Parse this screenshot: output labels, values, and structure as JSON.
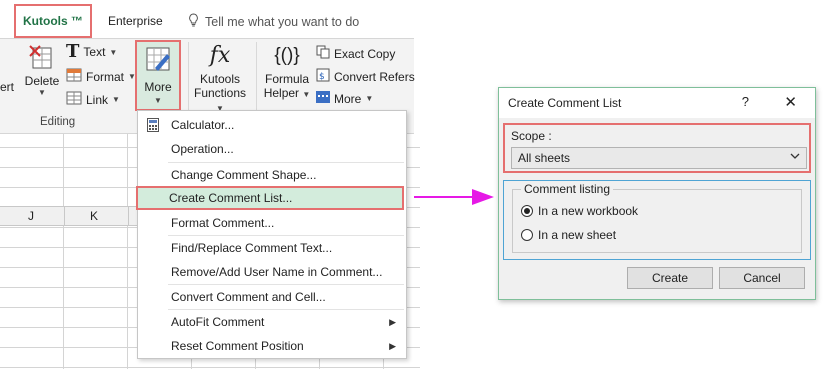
{
  "ribbon": {
    "tabs": {
      "kutools": "Kutools ™",
      "enterprise": "Enterprise"
    },
    "tell_me": "Tell me what you want to do",
    "editing": {
      "ert_label": "ert",
      "delete_label": "Delete",
      "text_label": "Text",
      "format_label": "Format",
      "link_label": "Link",
      "group_label": "Editing"
    },
    "more_label": "More",
    "functions": {
      "line1": "Kutools",
      "line2": "Functions"
    },
    "formula": {
      "line1": "Formula",
      "line2": "Helper"
    },
    "exact_copy": "Exact Copy",
    "convert_refers": "Convert Refers",
    "more_small": "More"
  },
  "sheet": {
    "columns": [
      "J",
      "K"
    ]
  },
  "menu": {
    "items": [
      {
        "label": "Calculator..."
      },
      {
        "label": "Operation..."
      },
      {
        "label": "Change Comment Shape..."
      },
      {
        "label": "Create Comment List..."
      },
      {
        "label": "Format Comment..."
      },
      {
        "label": "Find/Replace Comment Text..."
      },
      {
        "label": "Remove/Add User Name in Comment..."
      },
      {
        "label": "Convert Comment and Cell..."
      },
      {
        "label": "AutoFit Comment"
      },
      {
        "label": "Reset Comment Position"
      }
    ]
  },
  "dialog": {
    "title": "Create Comment List",
    "help": "?",
    "close": "✕",
    "scope_label": "Scope :",
    "scope_value": "All sheets",
    "listing_legend": "Comment listing",
    "radio_workbook": "In a new workbook",
    "radio_sheet": "In a new sheet",
    "create_button": "Create",
    "cancel_button": "Cancel"
  },
  "colors": {
    "highlight_border": "#e56f6f",
    "kutools_green": "#217346",
    "arrow": "#e619e6",
    "menu_highlight": "#d3ecdc"
  }
}
